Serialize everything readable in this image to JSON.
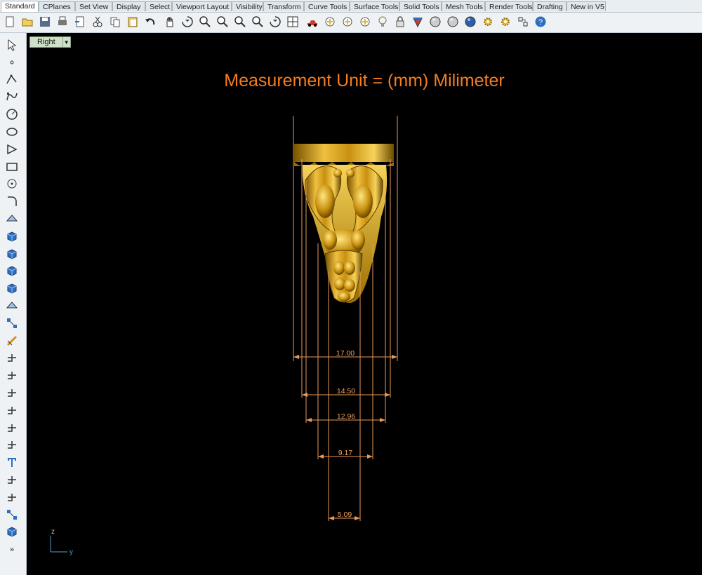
{
  "tabs": [
    "Standard",
    "CPlanes",
    "Set View",
    "Display",
    "Select",
    "Viewport Layout",
    "Visibility",
    "Transform",
    "Curve Tools",
    "Surface Tools",
    "Solid Tools",
    "Mesh Tools",
    "Render Tools",
    "Drafting",
    "New in V5"
  ],
  "active_tab": "Standard",
  "viewport": {
    "name": "Right",
    "heading": "Measurement Unit = (mm) Milimeter",
    "dimensions": [
      "17.00",
      "14.50",
      "12.96",
      "9.17",
      "5.09"
    ],
    "axis": {
      "vertical": "z",
      "horizontal": "y"
    }
  },
  "toolbar_icons": [
    "new-icon",
    "open-icon",
    "save-icon",
    "print-icon",
    "import-icon",
    "cut-icon",
    "copy-icon",
    "paste-icon",
    "undo-icon",
    "pan-icon",
    "rotate-view-icon",
    "zoom-dynamic-icon",
    "zoom-window-icon",
    "zoom-extents-icon",
    "zoom-selected-icon",
    "rotate-view-2-icon",
    "four-viewports-icon",
    "car-icon",
    "display-mode-icon",
    "object-properties-icon",
    "layer-icon",
    "light-icon",
    "lock-icon",
    "materials-icon",
    "render-preview-icon",
    "render-icon",
    "render-sphere-icon",
    "options-icon",
    "tools-gear-icon",
    "snap-icon",
    "help-icon"
  ],
  "left_icons": [
    "select-arrow-icon",
    "point-icon",
    "polyline-icon",
    "curve-icon",
    "circle-icon",
    "ellipse-icon",
    "polygon-icon",
    "rectangle-icon",
    "arc-icon",
    "fillet-icon",
    "surface-icon",
    "extrude-icon",
    "box-icon",
    "boolean-icon",
    "cylinder-icon",
    "mesh-icon",
    "transform-icon",
    "analyze-icon",
    "dimension-icon",
    "leader-icon",
    "group-icon",
    "block-icon",
    "curve-from-object-icon",
    "rebuild-icon",
    "text-icon",
    "point-edit-icon",
    "arrange-icon",
    "array-icon",
    "solid-box-icon",
    "more-icon"
  ],
  "colors": {
    "accent": "#f47d1f",
    "dimension": "#e89a58",
    "gold": "#d4a017"
  }
}
